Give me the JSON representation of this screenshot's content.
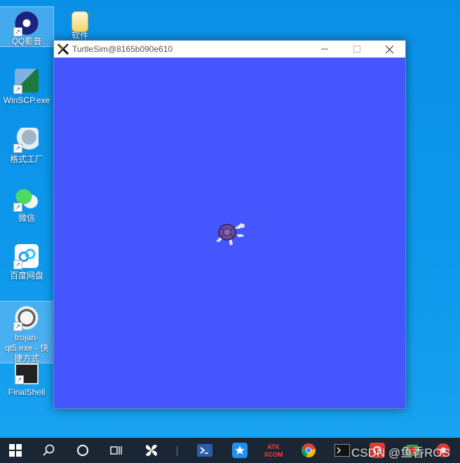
{
  "desktop": {
    "icons": [
      {
        "label": "QQ影音"
      },
      {
        "label": "WinSCP.exe"
      },
      {
        "label": "格式工厂"
      },
      {
        "label": "微信"
      },
      {
        "label": "百度网盘"
      },
      {
        "label": "trojan-qt5.exe - 快捷方式"
      },
      {
        "label": "FinalShell"
      },
      {
        "label": "软件"
      }
    ]
  },
  "window": {
    "title": "TurtleSim@8165b090e610",
    "canvas_color": "#4556ff"
  },
  "taskbar": {
    "watermark": "CSDN @鱼香ROS"
  },
  "colors": {
    "desktop_bg": "#0d98ec",
    "taskbar_bg": "#1a2633"
  }
}
